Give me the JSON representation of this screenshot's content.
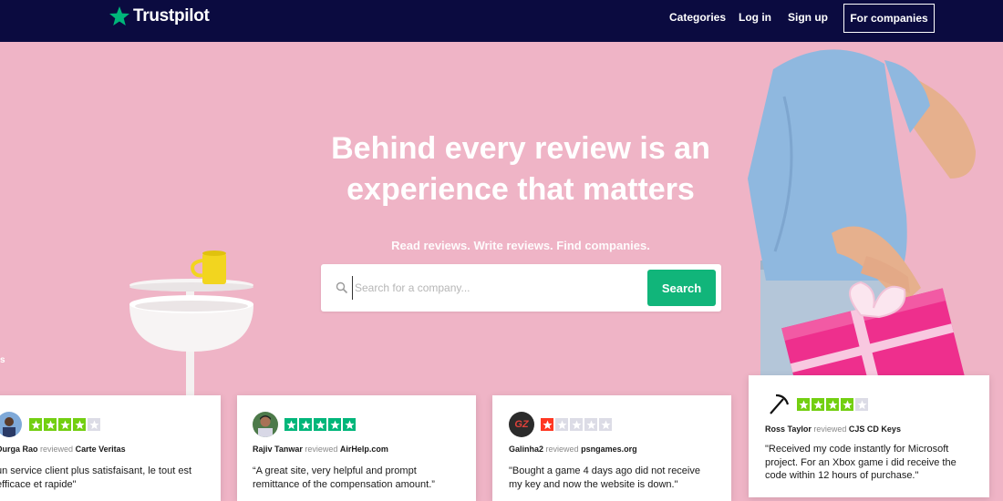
{
  "brand": {
    "name": "Trustpilot",
    "color": "#00b67a",
    "nav_bg": "#0b0b40"
  },
  "nav": {
    "categories": "Categories",
    "login": "Log in",
    "signup": "Sign up",
    "for_companies": "For companies"
  },
  "hero": {
    "title_line1": "Behind every review is an",
    "title_line2": "experience that matters",
    "subtitle": "Read reviews. Write reviews. Find companies.",
    "background": "#efb4c6",
    "side_fragment": "s"
  },
  "search": {
    "placeholder": "Search for a company...",
    "value": "",
    "button_label": "Search",
    "icon": "search-icon"
  },
  "reviews": [
    {
      "reviewer": "Durga Rao",
      "reviewed_label": "reviewed",
      "company": "Carte Veritas",
      "rating": 4,
      "quote_line1": "un service client plus satisfaisant, le tout est",
      "quote_line2": "efficace et rapide\""
    },
    {
      "reviewer": "Rajiv Tanwar",
      "reviewed_label": "reviewed",
      "company": "AirHelp.com",
      "rating": 5,
      "quote_line1": "“A great site, very helpful and prompt",
      "quote_line2": "remittance of the compensation amount.”"
    },
    {
      "reviewer": "Galinha2",
      "reviewed_label": "reviewed",
      "company": "psngames.org",
      "rating": 1,
      "avatar_text": "GZ",
      "quote_line1": "\"Bought a game 4 days ago did not receive",
      "quote_line2": "my key and now the website is down.\""
    },
    {
      "reviewer": "Ross Taylor",
      "reviewed_label": "reviewed",
      "company": "CJS CD Keys",
      "rating": 4,
      "quote_line1": "\"Received my code instantly for Microsoft",
      "quote_line2": "project. For an Xbox game i did receive the",
      "quote_line3": "code within 12 hours of purchase.\""
    }
  ],
  "star_colors": {
    "five": "#00b67a",
    "four": "#73cf11",
    "one": "#ff3722",
    "empty": "#dcdce6"
  }
}
